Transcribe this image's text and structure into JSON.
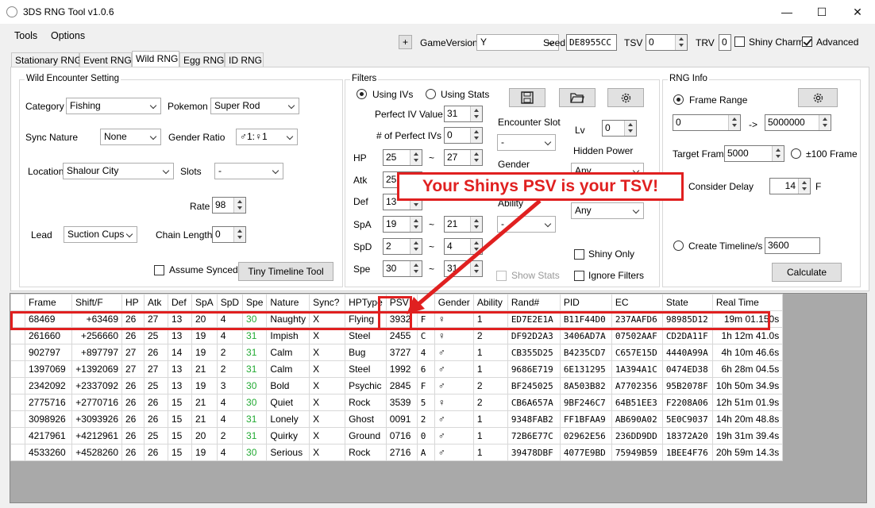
{
  "window": {
    "title": "3DS RNG Tool v1.0.6",
    "minimize": "—",
    "maximize": "☐",
    "close": "✕"
  },
  "menu": [
    "Tools",
    "Options"
  ],
  "toolbar": {
    "plus": "+",
    "game_version_label": "GameVersion",
    "game_version": "Y",
    "seed_label": "Seed",
    "seed": "DE8955CC",
    "tsv_label": "TSV",
    "tsv": "0",
    "trv_label": "TRV",
    "trv": "0",
    "shiny_charm_label": "Shiny Charm",
    "shiny_charm": false,
    "advanced_label": "Advanced",
    "advanced": true
  },
  "tabs": [
    "Stationary RNG",
    "Event RNG",
    "Wild RNG",
    "Egg RNG",
    "ID RNG"
  ],
  "active_tab": "Wild RNG",
  "wild": {
    "title": "Wild Encounter Setting",
    "category_label": "Category",
    "category": "Fishing",
    "pokemon_label": "Pokemon",
    "pokemon": "Super Rod",
    "sync_label": "Sync Nature",
    "sync": "None",
    "gender_ratio_label": "Gender Ratio",
    "gender_ratio": "♂1:♀1",
    "location_label": "Location",
    "location": "Shalour City",
    "slots_label": "Slots",
    "slots": "-",
    "rate_label": "Rate",
    "rate": "98",
    "lead_label": "Lead",
    "lead": "Suction Cups",
    "chain_label": "Chain Length",
    "chain": "0",
    "assume_synced_label": "Assume Synced",
    "tiny_timeline": "Tiny Timeline Tool"
  },
  "filters": {
    "title": "Filters",
    "using_ivs": "Using IVs",
    "using_stats": "Using Stats",
    "perfect_iv_label": "Perfect IV Value",
    "perfect_iv": "31",
    "num_perfect_label": "# of Perfect IVs",
    "num_perfect": "0",
    "tilde": "~",
    "ivs": [
      {
        "stat": "HP",
        "min": "25",
        "max": "27"
      },
      {
        "stat": "Atk",
        "min": "25",
        "max": ""
      },
      {
        "stat": "Def",
        "min": "13",
        "max": ""
      },
      {
        "stat": "SpA",
        "min": "19",
        "max": "21"
      },
      {
        "stat": "SpD",
        "min": "2",
        "max": "4"
      },
      {
        "stat": "Spe",
        "min": "30",
        "max": "31"
      }
    ],
    "encounter_slot_label": "Encounter Slot",
    "encounter_slot": "-",
    "lv_label": "Lv",
    "lv": "0",
    "hidden_power_label": "Hidden Power",
    "hidden_power": "Any",
    "gender_label": "Gender",
    "ability_label": "Ability",
    "ability": "-",
    "nature": "Any",
    "shiny_only_label": "Shiny Only",
    "show_stats_label": "Show Stats",
    "ignore_filters_label": "Ignore Filters"
  },
  "rng_info": {
    "title": "RNG Info",
    "frame_range_label": "Frame Range",
    "frame_min": "0",
    "arrow": "->",
    "frame_max": "5000000",
    "target_label": "Target Frame",
    "target": "5000",
    "plus100_label": "±100 Frame",
    "delay_label": "Consider Delay",
    "delay": "14",
    "delay_unit": "F",
    "timeline_label": "Create Timeline/s",
    "timeline": "3600",
    "calculate": "Calculate"
  },
  "callout": "Your Shinys PSV is your TSV!",
  "grid": {
    "columns": [
      "Frame",
      "Shift/F",
      "HP",
      "Atk",
      "Def",
      "SpA",
      "SpD",
      "Spe",
      "Nature",
      "Sync?",
      "HPType",
      "PSV",
      "",
      "Gender",
      "Ability",
      "Rand#",
      "PID",
      "EC",
      "State",
      "Real Time"
    ],
    "rows": [
      [
        "68469",
        "+63469",
        "26",
        "27",
        "13",
        "20",
        "4",
        "30",
        "Naughty",
        "X",
        "Flying",
        "3932",
        "F",
        "♀",
        "1",
        "ED7E2E1A",
        "B11F44D0",
        "237AAFD6",
        "98985D12",
        "19m 01.150s"
      ],
      [
        "261660",
        "+256660",
        "26",
        "25",
        "13",
        "19",
        "4",
        "31",
        "Impish",
        "X",
        "Steel",
        "2455",
        "C",
        "♀",
        "2",
        "DF92D2A3",
        "3406AD7A",
        "07502AAF",
        "CD2DA11F",
        "1h 12m 41.0s"
      ],
      [
        "902797",
        "+897797",
        "27",
        "26",
        "14",
        "19",
        "2",
        "31",
        "Calm",
        "X",
        "Bug",
        "3727",
        "4",
        "♂",
        "1",
        "CB355D25",
        "B4235CD7",
        "C657E15D",
        "4440A99A",
        "4h 10m 46.6s"
      ],
      [
        "1397069",
        "+1392069",
        "27",
        "27",
        "13",
        "21",
        "2",
        "31",
        "Calm",
        "X",
        "Steel",
        "1992",
        "6",
        "♂",
        "1",
        "9686E719",
        "6E131295",
        "1A394A1C",
        "0474ED38",
        "6h 28m 04.5s"
      ],
      [
        "2342092",
        "+2337092",
        "26",
        "25",
        "13",
        "19",
        "3",
        "30",
        "Bold",
        "X",
        "Psychic",
        "2845",
        "F",
        "♂",
        "2",
        "BF245025",
        "8A503B82",
        "A7702356",
        "95B2078F",
        "10h 50m 34.9s"
      ],
      [
        "2775716",
        "+2770716",
        "26",
        "26",
        "15",
        "21",
        "4",
        "30",
        "Quiet",
        "X",
        "Rock",
        "3539",
        "5",
        "♀",
        "2",
        "CB6A657A",
        "9BF246C7",
        "64B51EE3",
        "F2208A06",
        "12h 51m 01.9s"
      ],
      [
        "3098926",
        "+3093926",
        "26",
        "26",
        "15",
        "21",
        "4",
        "31",
        "Lonely",
        "X",
        "Ghost",
        "0091",
        "2",
        "♂",
        "1",
        "9348FAB2",
        "FF1BFAA9",
        "AB690A02",
        "5E0C9037",
        "14h 20m 48.8s"
      ],
      [
        "4217961",
        "+4212961",
        "26",
        "25",
        "15",
        "20",
        "2",
        "31",
        "Quirky",
        "X",
        "Ground",
        "0716",
        "0",
        "♂",
        "1",
        "72B6E77C",
        "02962E56",
        "236DD9DD",
        "18372A20",
        "19h 31m 39.4s"
      ],
      [
        "4533260",
        "+4528260",
        "26",
        "26",
        "15",
        "19",
        "4",
        "30",
        "Serious",
        "X",
        "Rock",
        "2716",
        "A",
        "♂",
        "1",
        "39478DBF",
        "4077E9BD",
        "75949B59",
        "1BEE4F76",
        "20h 59m 14.3s"
      ]
    ]
  },
  "colors": {
    "highlight": "#e02020",
    "perfect_iv": "#22aa33"
  }
}
